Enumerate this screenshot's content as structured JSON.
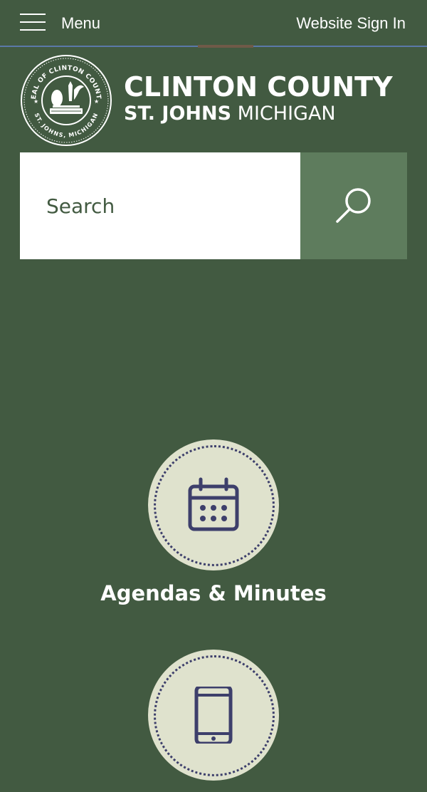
{
  "header": {
    "menu_label": "Menu",
    "signin_label": "Website Sign In"
  },
  "brand": {
    "line1": "CLINTON COUNTY",
    "line2_bold": "ST. JOHNS",
    "line2_regular": "MICHIGAN",
    "seal_top_text": "SEAL OF CLINTON COUNTY",
    "seal_bottom_text": "ST. JOHNS, MICHIGAN"
  },
  "search": {
    "placeholder": "Search"
  },
  "quicklinks": [
    {
      "label": "Agendas & Minutes",
      "icon": "calendar-icon"
    },
    {
      "label": "",
      "icon": "mobile-phone-icon"
    }
  ],
  "colors": {
    "background": "#425a41",
    "search_button": "#5e7c5d",
    "circle": "#dfe2cd",
    "icon": "#3d3f6b"
  }
}
